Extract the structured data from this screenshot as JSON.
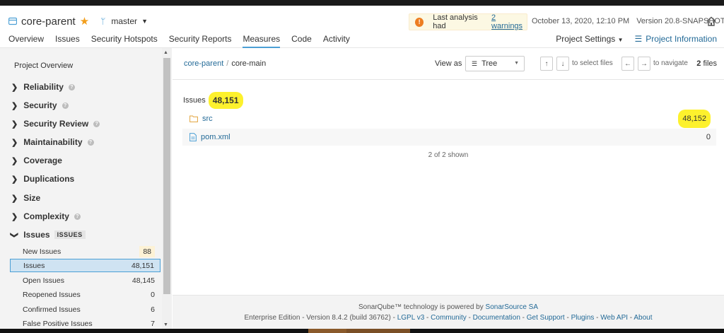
{
  "header": {
    "project_name": "core-parent",
    "branch": "master",
    "warning_prefix": "Last analysis had",
    "warning_link": "2 warnings",
    "date": "October 13, 2020, 12:10 PM",
    "version": "Version 20.8-SNAPSHOT"
  },
  "nav": {
    "tabs": [
      {
        "label": "Overview"
      },
      {
        "label": "Issues"
      },
      {
        "label": "Security Hotspots"
      },
      {
        "label": "Security Reports"
      },
      {
        "label": "Measures"
      },
      {
        "label": "Code"
      },
      {
        "label": "Activity"
      }
    ],
    "active_tab": "Measures",
    "settings_label": "Project Settings",
    "info_label": "Project Information"
  },
  "sidebar": {
    "title": "Project Overview",
    "domains": [
      {
        "label": "Reliability"
      },
      {
        "label": "Security"
      },
      {
        "label": "Security Review"
      },
      {
        "label": "Maintainability"
      },
      {
        "label": "Coverage"
      },
      {
        "label": "Duplications"
      },
      {
        "label": "Size"
      },
      {
        "label": "Complexity"
      },
      {
        "label": "Issues",
        "tag": "ISSUES"
      }
    ],
    "sub_items": [
      {
        "label": "New Issues",
        "value": "88"
      },
      {
        "label": "Issues",
        "value": "48,151"
      },
      {
        "label": "Open Issues",
        "value": "48,145"
      },
      {
        "label": "Reopened Issues",
        "value": "0"
      },
      {
        "label": "Confirmed Issues",
        "value": "6"
      },
      {
        "label": "False Positive Issues",
        "value": "7"
      }
    ]
  },
  "main": {
    "breadcrumb": [
      "core-parent",
      "core-main"
    ],
    "view_as_label": "View as",
    "view_mode": "Tree",
    "select_hint": "to select files",
    "navigate_hint": "to navigate",
    "files_count": "2",
    "files_label": "files",
    "metric_label": "Issues",
    "metric_value": "48,151",
    "rows": [
      {
        "name": "src",
        "value": "48,152",
        "icon": "folder-icon"
      },
      {
        "name": "pom.xml",
        "value": "0",
        "icon": "file-icon"
      }
    ],
    "shown_text": "2 of 2 shown"
  },
  "footer": {
    "line1_prefix": "SonarQube™ technology is powered by",
    "line1_link": "SonarSource SA",
    "edition": "Enterprise Edition - Version 8.4.2 (build 36762) -",
    "links": [
      "LGPL v3",
      "Community",
      "Documentation",
      "Get Support",
      "Plugins",
      "Web API",
      "About"
    ]
  },
  "colors": {
    "accent": "#4b9fd5",
    "link": "#236a97",
    "highlight": "#fdf12d",
    "warning": "#ed7d20",
    "star": "#f29e1c"
  }
}
